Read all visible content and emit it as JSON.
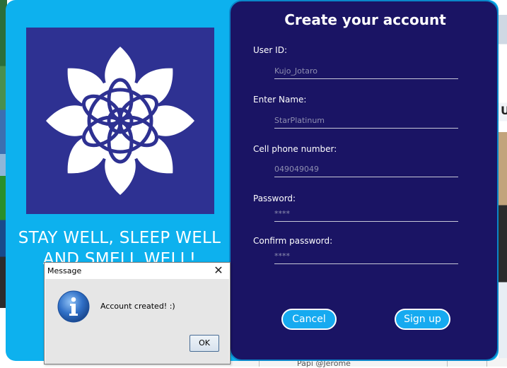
{
  "window": {
    "slogan_line1": "STAY WELL, SLEEP WELL",
    "slogan_line2": "AND SMELL WELL!"
  },
  "form": {
    "title": "Create your account",
    "fields": [
      {
        "label": "User ID:",
        "value": "Kujo_Jotaro"
      },
      {
        "label": "Enter Name:",
        "value": "StarPlatinum"
      },
      {
        "label": "Cell phone number:",
        "value": "049049049"
      },
      {
        "label": "Password:",
        "value": "****"
      },
      {
        "label": "Confirm password:",
        "value": "****"
      }
    ],
    "cancel_label": "Cancel",
    "signup_label": "Sign up"
  },
  "dialog": {
    "title": "Message",
    "message": "Account created! :)",
    "ok_label": "OK",
    "close_glyph": "✕",
    "icon": "info-icon"
  },
  "background": {
    "right_glyph": "U",
    "bottom_text": "Papi @Jerome"
  },
  "colors": {
    "app_bg": "#0db1ee",
    "logo_bg": "#2e3192",
    "form_bg": "#1a1464",
    "button_bg": "#16aaf0"
  }
}
